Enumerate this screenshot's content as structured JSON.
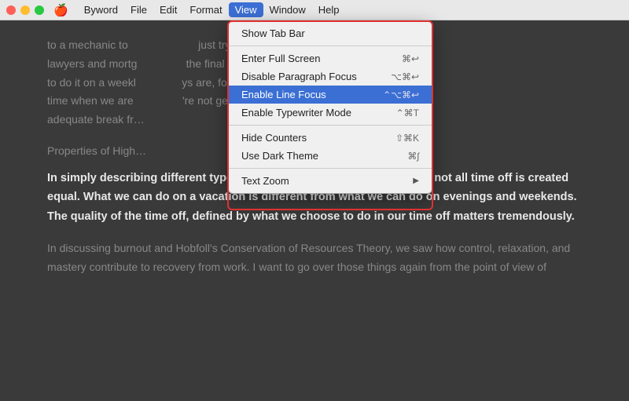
{
  "menubar": {
    "apple_icon": "🍎",
    "items": [
      {
        "label": "Byword",
        "active": false
      },
      {
        "label": "File",
        "active": false
      },
      {
        "label": "Edit",
        "active": false
      },
      {
        "label": "Format",
        "active": false
      },
      {
        "label": "View",
        "active": true
      },
      {
        "label": "Window",
        "active": false
      },
      {
        "label": "Help",
        "active": false
      }
    ]
  },
  "dropdown": {
    "items": [
      {
        "label": "Show Tab Bar",
        "shortcut": "",
        "selected": false,
        "separator_after": true,
        "has_submenu": false
      },
      {
        "label": "Enter Full Screen",
        "shortcut": "⌘↩",
        "selected": false,
        "separator_after": false,
        "has_submenu": false
      },
      {
        "label": "Disable Paragraph Focus",
        "shortcut": "⌥⌘↩",
        "selected": false,
        "separator_after": false,
        "has_submenu": false
      },
      {
        "label": "Enable Line Focus",
        "shortcut": "⌃⌥⌘↩",
        "selected": true,
        "separator_after": false,
        "has_submenu": false
      },
      {
        "label": "Enable Typewriter Mode",
        "shortcut": "⌃⌘T",
        "selected": false,
        "separator_after": true,
        "has_submenu": false
      },
      {
        "label": "Hide Counters",
        "shortcut": "⇧⌘K",
        "selected": false,
        "separator_after": false,
        "has_submenu": false
      },
      {
        "label": "Use Dark Theme",
        "shortcut": "⌘ʃ",
        "selected": false,
        "separator_after": true,
        "has_submenu": false
      },
      {
        "label": "Text Zoom",
        "shortcut": "",
        "selected": false,
        "separator_after": false,
        "has_submenu": true
      }
    ]
  },
  "content": {
    "paragraph1": "to a mechanic to ... just try getting all the lawyers and mortg... the final sale of a home to do it on a weekl... ys are, for the most part, time when we are... 're not getting an adequate break fr...",
    "properties_heading": "Properties of High...",
    "paragraph_bold": "In simply describing different types of time off, we can already see that not all time off is created equal. What we can do on a vacation is different from what we can do on evenings and weekends. The quality of the time off, defined by what we choose to do in our time off matters tremendously.",
    "paragraph_light": "In discussing burnout and Hobfoll's Conservation of Resources Theory, we saw how control, relaxation, and mastery contribute to recovery from work. I want to go over those things again from the point of view of"
  }
}
